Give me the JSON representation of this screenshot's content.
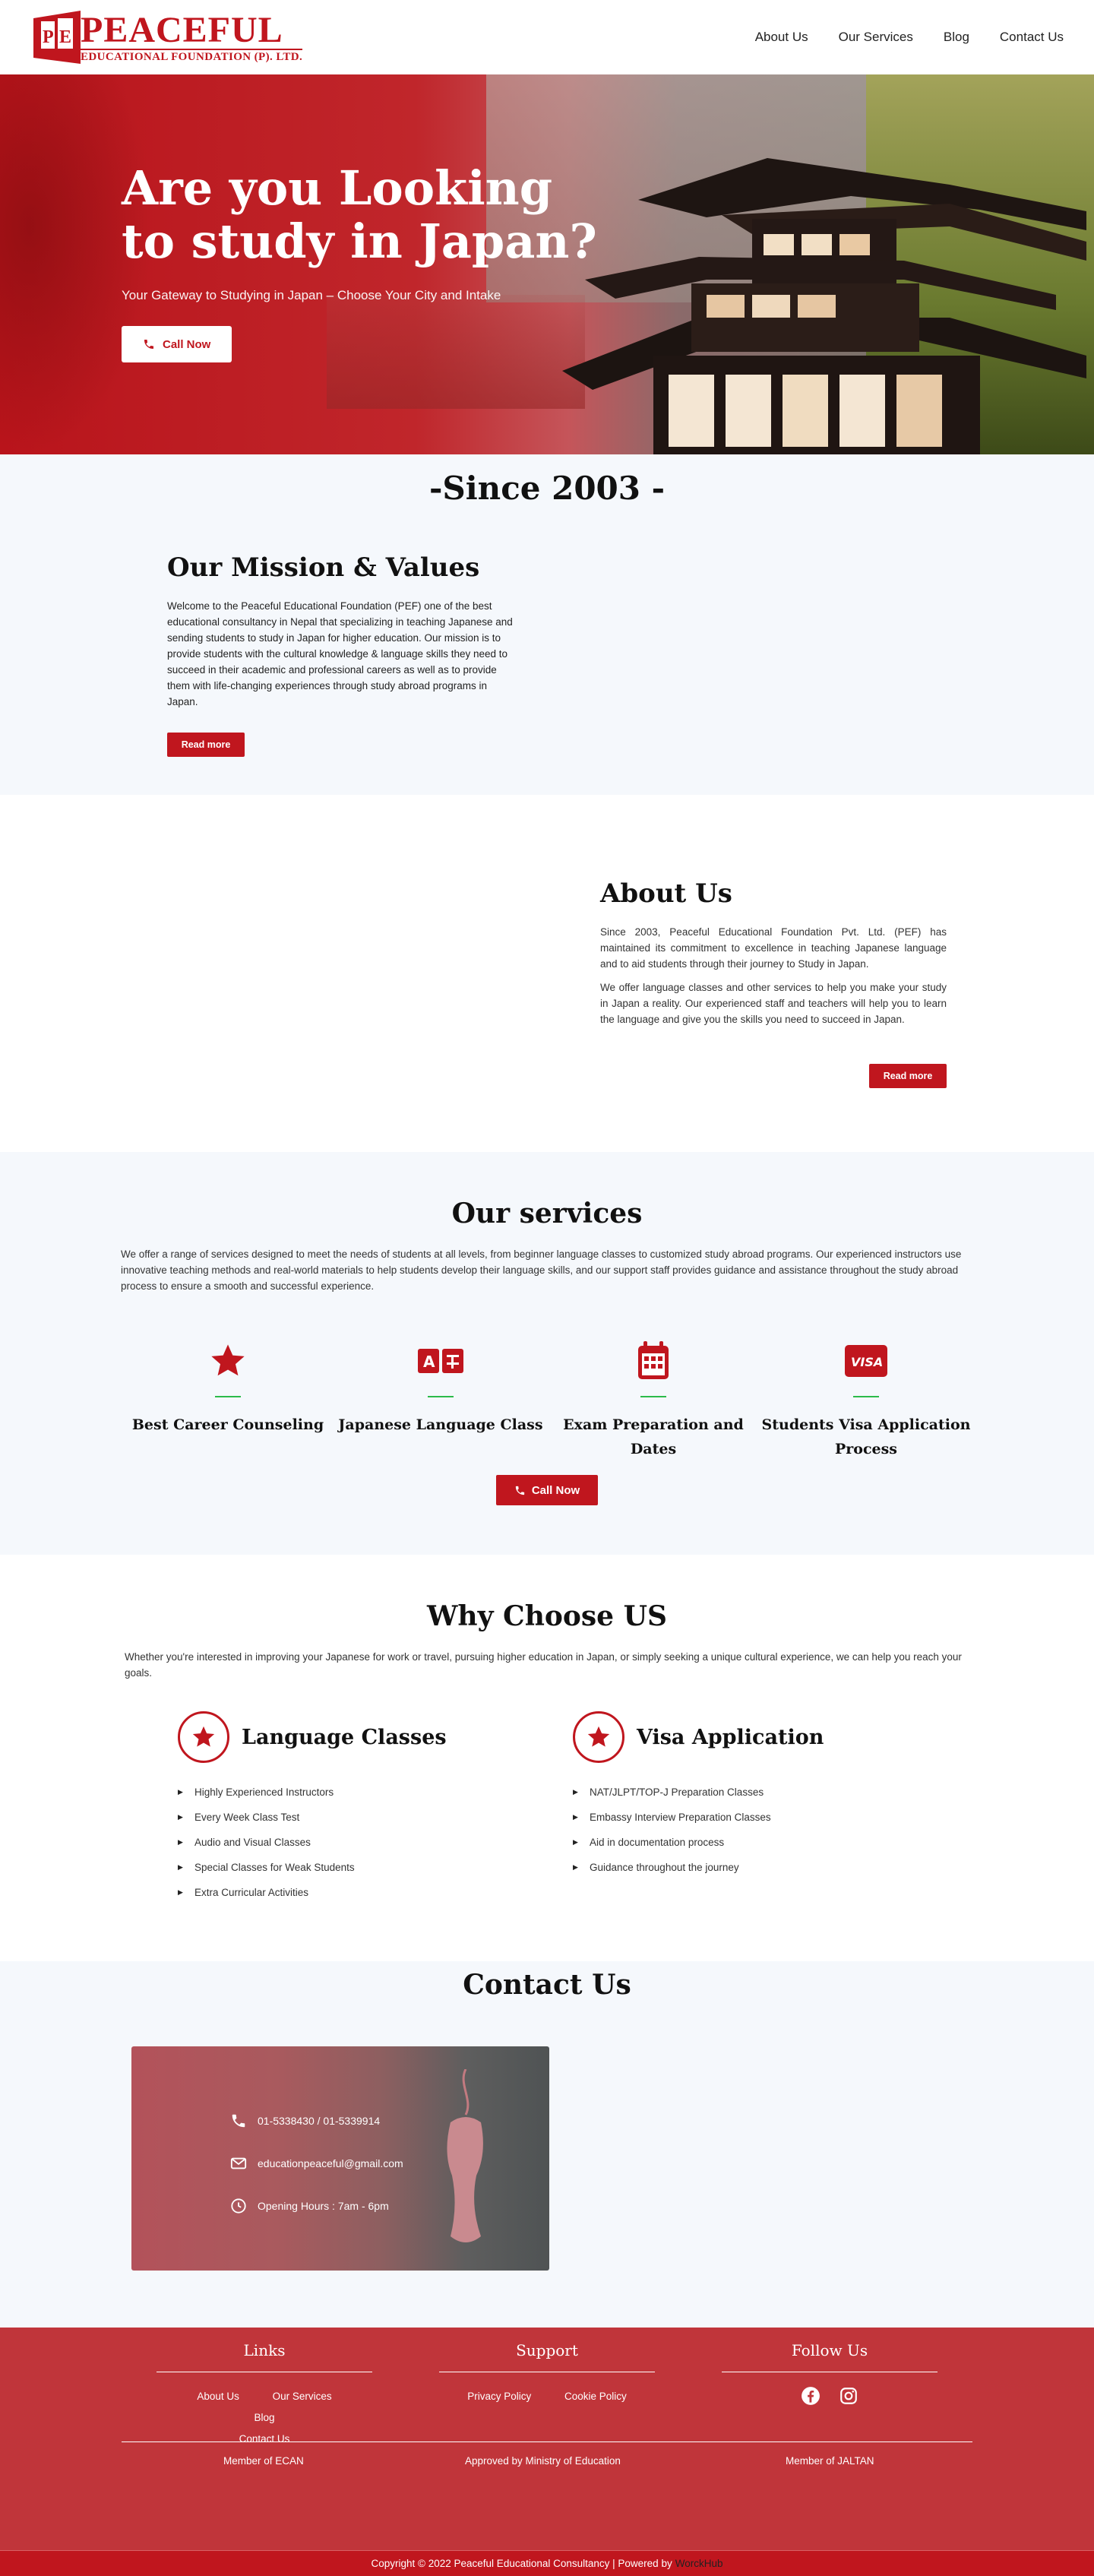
{
  "header": {
    "logo_big": "PEACEFUL",
    "logo_small": "EDUCATIONAL FOUNDATION (P). LTD.",
    "nav": [
      "About Us",
      "Our Services",
      "Blog",
      "Contact Us"
    ]
  },
  "hero": {
    "title_line1": "Are you Looking",
    "title_line2": "to study in Japan?",
    "subtitle": "Your Gateway to Studying in Japan – Choose Your City and Intake",
    "cta": "Call Now"
  },
  "since": {
    "title": "-Since 2003 -"
  },
  "mission": {
    "title": "Our Mission & Values",
    "text": "Welcome to the Peaceful Educational Foundation (PEF) one of the best educational consultancy in Nepal that specializing in teaching Japanese and sending students to study in Japan for higher education. Our mission is to provide students with the cultural knowledge & language skills they need to succeed in their academic and professional careers as well as to provide them with life-changing experiences through study abroad programs in Japan.",
    "button": "Read more"
  },
  "about": {
    "title": "About Us",
    "p1": "Since 2003, Peaceful Educational Foundation Pvt. Ltd. (PEF) has maintained its commitment to excellence in teaching Japanese language and to aid students through their journey to Study in Japan.",
    "p2": "We offer language classes and other services to help you make your study in Japan a reality. Our experienced staff and teachers will help you to learn the language and give you the skills you need to succeed in Japan.",
    "button": "Read more"
  },
  "services": {
    "title": "Our services",
    "intro": "We offer a range of services designed to meet the needs of students at all levels, from beginner language classes to customized study abroad programs. Our experienced instructors use innovative teaching methods and real-world materials to help students develop their language skills, and our support staff provides guidance and assistance throughout the study abroad process to ensure a smooth and successful experience.",
    "items": [
      {
        "label": "Best Career Counseling",
        "icon": "star-icon"
      },
      {
        "label": "Japanese Language Class",
        "icon": "translate-icon"
      },
      {
        "label": "Exam Preparation and Dates",
        "icon": "calendar-icon"
      },
      {
        "label": "Students Visa Application Process",
        "icon": "visa-card-icon"
      }
    ],
    "cta": "Call Now"
  },
  "why": {
    "title": "Why Choose US",
    "intro": "Whether you're interested in improving your Japanese for work or travel, pursuing higher education in Japan, or simply seeking a unique cultural experience, we can help you reach your goals.",
    "columns": [
      {
        "heading": "Language Classes",
        "items": [
          "Highly Experienced Instructors",
          "Every Week Class Test",
          "Audio and Visual Classes",
          "Special Classes for Weak Students",
          "Extra Curricular Activities"
        ]
      },
      {
        "heading": "Visa Application",
        "items": [
          "NAT/JLPT/TOP-J Preparation Classes",
          "Embassy Interview Preparation Classes",
          "Aid in documentation process",
          "Guidance throughout the journey"
        ]
      }
    ]
  },
  "contact": {
    "title": "Contact Us",
    "phone": "01-5338430 / 01-5339914",
    "email": "educationpeaceful@gmail.com",
    "hours": "Opening Hours : 7am - 6pm"
  },
  "footer": {
    "links_title": "Links",
    "links": [
      "About Us",
      "Our Services",
      "Blog",
      "Contact Us"
    ],
    "support_title": "Support",
    "support": [
      "Privacy Policy",
      "Cookie Policy"
    ],
    "follow_title": "Follow Us",
    "member1": "Member of ECAN",
    "member2": "Approved by Ministry of Education",
    "member3": "Member of JALTAN",
    "copyright": "Copyright © 2022 Peaceful Educational Consultancy | Powered by",
    "powered_by": "WorckHub"
  },
  "colors": {
    "brand_red": "#c0161e",
    "accent_green": "#2cbb4a",
    "section_bg": "#f5f8fc",
    "footer_bg": "#c0353a"
  }
}
